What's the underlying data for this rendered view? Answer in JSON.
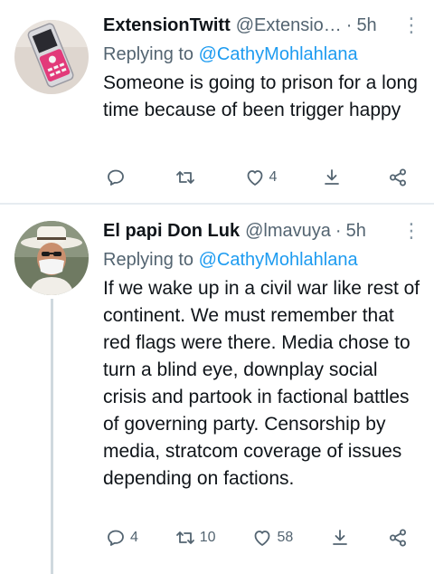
{
  "tweets": [
    {
      "name": "ExtensionTwitt",
      "handle": "@Extensio…",
      "time": "5h",
      "reply_prefix": "Replying to",
      "reply_to": "@CathyMohlahlana",
      "text": "Someone is going to prison for a long time because of been trigger happy",
      "replies": "",
      "retweets": "",
      "likes": "4"
    },
    {
      "name": "El papi Don Luk",
      "handle": "@lmavuya",
      "time": "5h",
      "reply_prefix": "Replying to",
      "reply_to": "@CathyMohlahlana",
      "text": "If we wake up in a civil war like rest of continent. We must remember that red flags were there. Media chose to turn a blind eye, downplay social crisis and partook in factional battles of governing party. Censorship by media, stratcom coverage of issues depending on factions.",
      "replies": "4",
      "retweets": "10",
      "likes": "58"
    }
  ],
  "icons": {
    "reply": "comment-bubble-icon",
    "retweet": "retweet-icon",
    "like": "heart-icon",
    "download": "download-icon",
    "share": "share-icon",
    "more": "chevron-down-icon"
  },
  "colors": {
    "link": "#1d9bf0",
    "secondary_text": "#536471",
    "divider": "#e6ecf0"
  }
}
